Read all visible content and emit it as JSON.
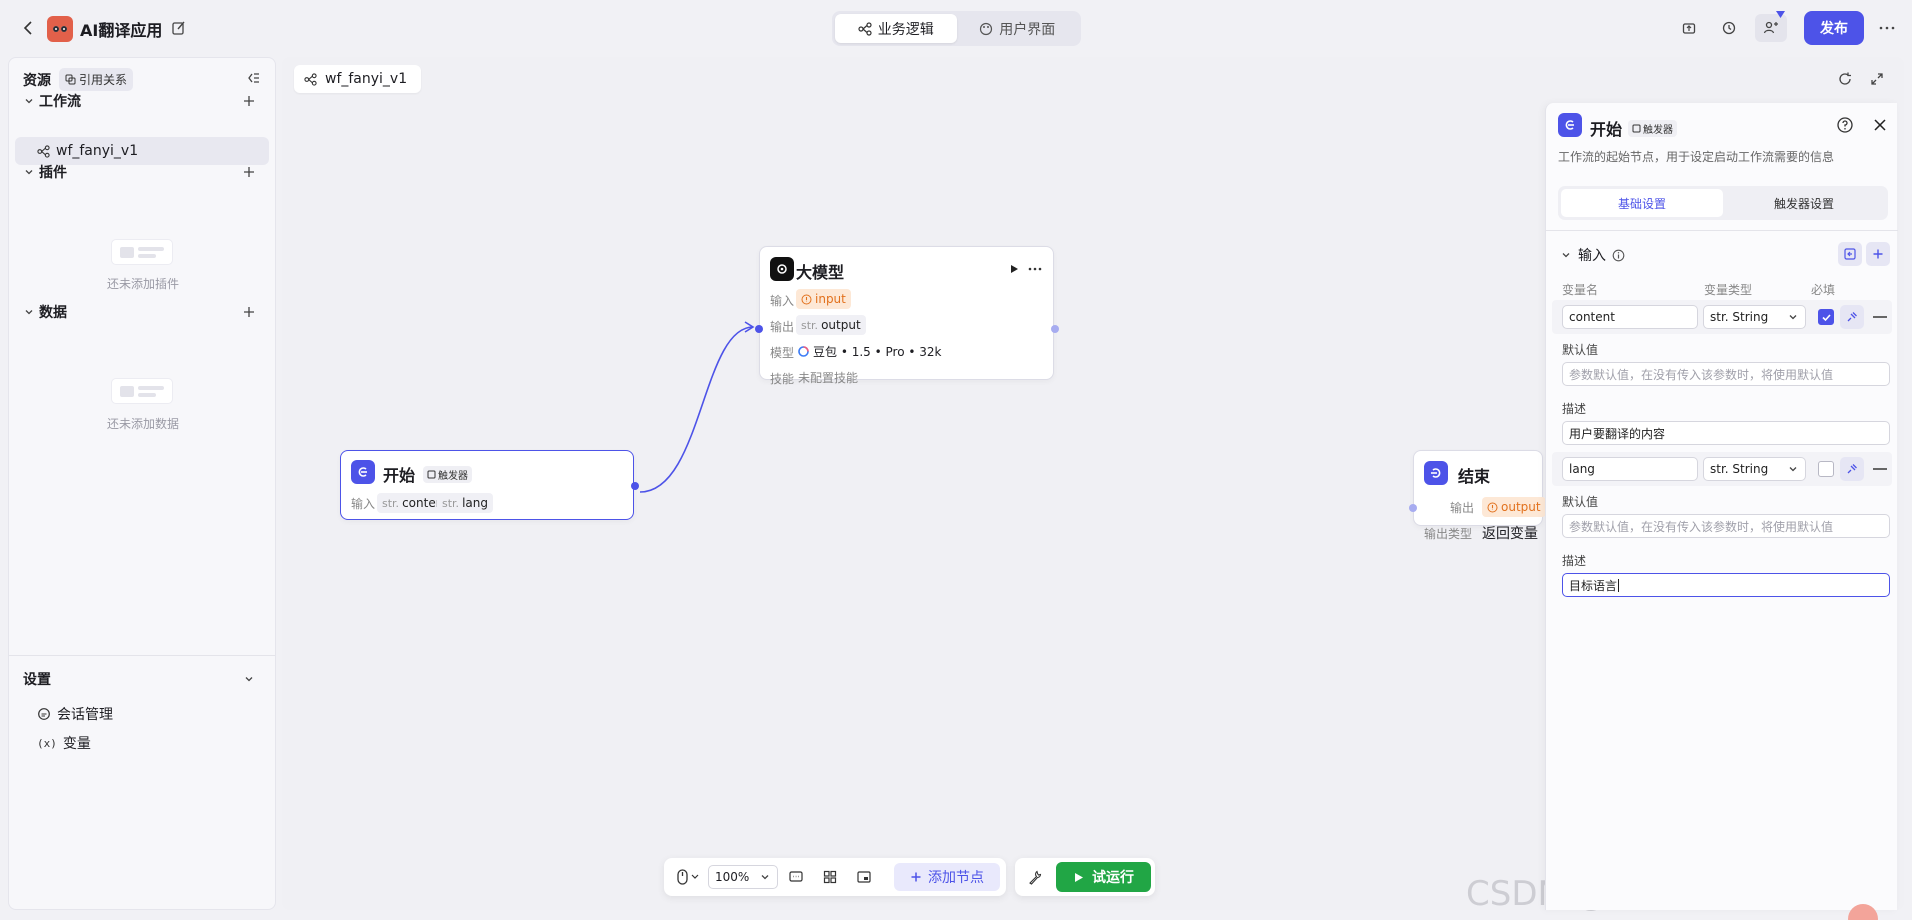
{
  "topbar": {
    "app_title": "AI翻译应用",
    "tabs": [
      {
        "label": "业务逻辑",
        "active": true
      },
      {
        "label": "用户界面",
        "active": false
      }
    ],
    "publish_label": "发布",
    "accent": "#4d53e8"
  },
  "sidebar": {
    "title": "资源",
    "ref_chip": "引用关系",
    "sections": {
      "workflow": {
        "label": "工作流",
        "items": [
          "wf_fanyi_v1"
        ]
      },
      "plugins": {
        "label": "插件",
        "empty_text": "还未添加插件"
      },
      "data": {
        "label": "数据",
        "empty_text": "还未添加数据"
      }
    },
    "settings": {
      "label": "设置",
      "items": [
        {
          "label": "会话管理",
          "icon": "conversation-icon"
        },
        {
          "label": "变量",
          "icon": "variable-icon"
        }
      ]
    }
  },
  "canvas": {
    "tab_label": "wf_fanyi_v1",
    "nodes": {
      "start": {
        "title": "开始",
        "trigger_chip": "触发器",
        "input_label": "输入",
        "inputs": [
          {
            "prefix": "str.",
            "name": "content"
          },
          {
            "prefix": "str.",
            "name": "lang"
          }
        ]
      },
      "llm": {
        "title": "大模型",
        "input_label": "输入",
        "input_value": "input",
        "output_label": "输出",
        "output_prefix": "str.",
        "output_value": "output",
        "model_label": "模型",
        "model_value": "豆包 • 1.5 • Pro • 32k",
        "skill_label": "技能",
        "skill_value": "未配置技能"
      },
      "end": {
        "title": "结束",
        "output_label": "输出",
        "output_value": "output",
        "output_type_label": "输出类型",
        "output_type_value": "返回变量"
      }
    }
  },
  "toolbar": {
    "zoom": "100%",
    "add_node_label": "添加节点",
    "run_label": "试运行",
    "run_color": "#21a645"
  },
  "panel": {
    "title": "开始",
    "trigger_chip": "触发器",
    "description": "工作流的起始节点，用于设定启动工作流需要的信息",
    "tabs": [
      {
        "label": "基础设置",
        "active": true
      },
      {
        "label": "触发器设置",
        "active": false
      }
    ],
    "section_label": "输入",
    "columns": {
      "name": "变量名",
      "type": "变量类型",
      "required": "必填"
    },
    "default_label": "默认值",
    "desc_label": "描述",
    "default_placeholder": "参数默认值，在没有传入该参数时，将使用默认值",
    "params": [
      {
        "name": "content",
        "type": "str. String",
        "required": true,
        "description": "用户要翻译的内容"
      },
      {
        "name": "lang",
        "type": "str. String",
        "required": false,
        "description": "目标语言"
      }
    ]
  },
  "watermark": "CSDN @热爱编程的通信人"
}
